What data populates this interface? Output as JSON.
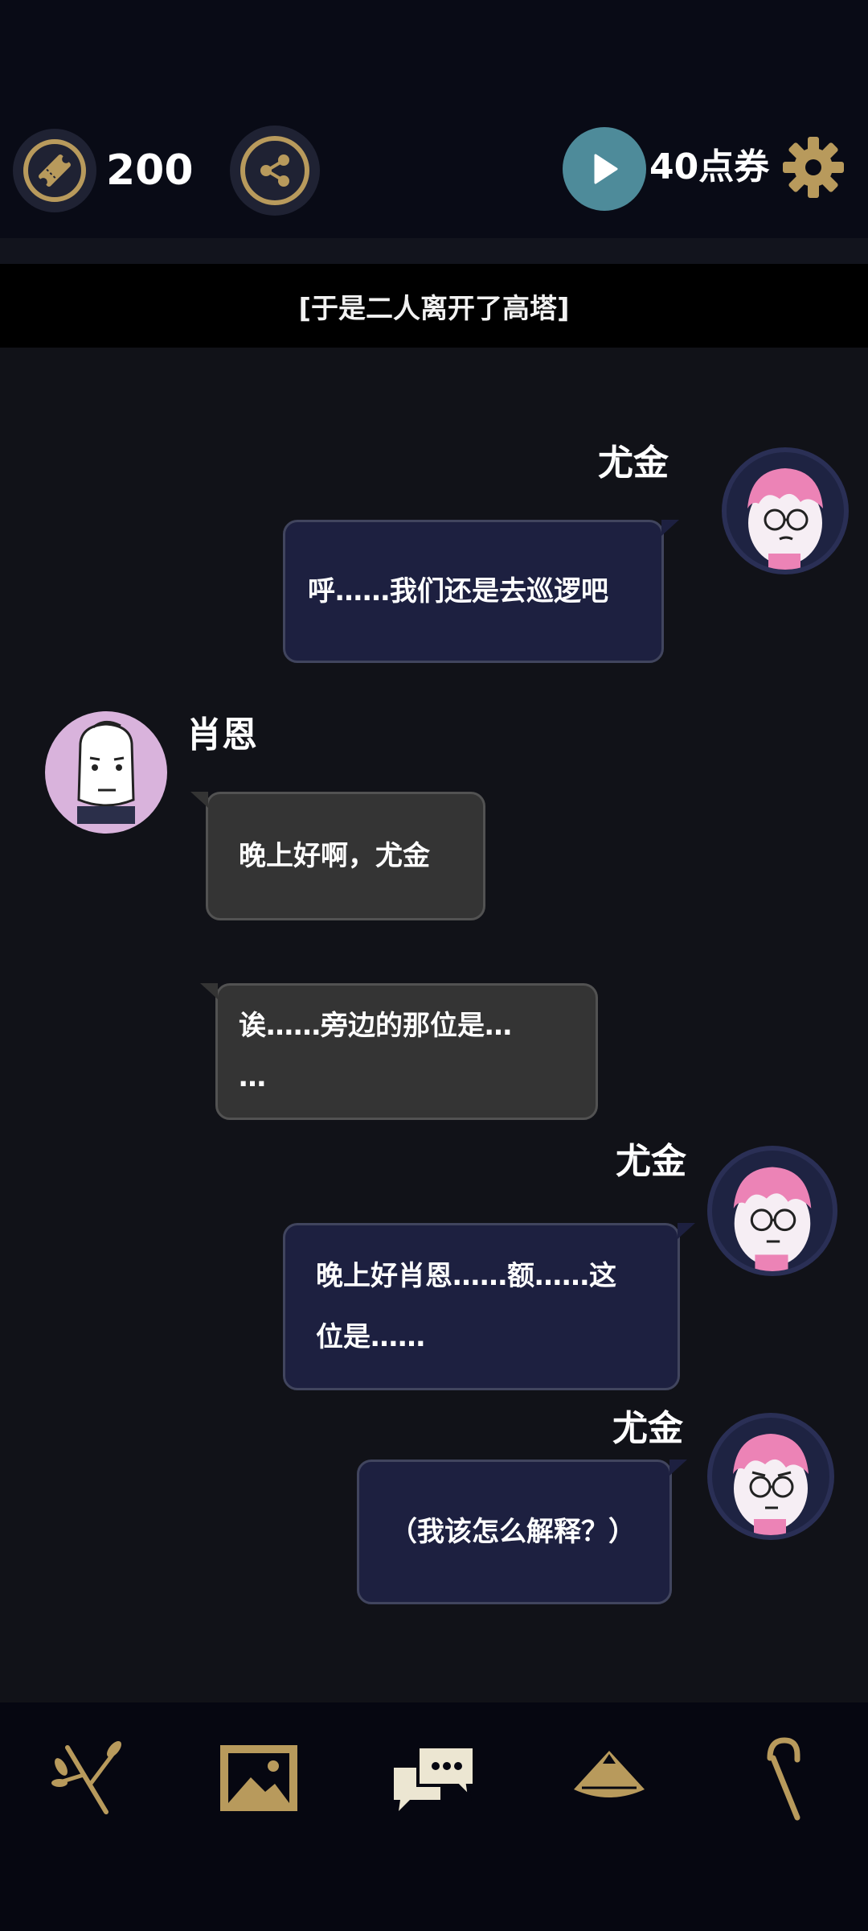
{
  "header": {
    "ticket_count": "200",
    "points_label": "40点券",
    "icons": {
      "ticket": "ticket-icon",
      "share": "share-icon",
      "play": "play-icon",
      "settings": "gear-icon"
    }
  },
  "narration": "[于是二人离开了高塔]",
  "messages": [
    {
      "speaker": "尤金",
      "side": "right",
      "lines": [
        "呼……我们还是去巡逻吧"
      ]
    },
    {
      "speaker": "肖恩",
      "side": "left",
      "lines": [
        "晚上好啊，尤金"
      ]
    },
    {
      "speaker": "",
      "side": "left",
      "lines": [
        "诶……旁边的那位是…",
        "…"
      ]
    },
    {
      "speaker": "尤金",
      "side": "right",
      "lines": [
        "晚上好肖恩……额……这",
        "位是……"
      ]
    },
    {
      "speaker": "尤金",
      "side": "right",
      "lines": [
        "（我该怎么解释？）"
      ]
    }
  ],
  "bottom_nav": {
    "items": [
      "branch-icon",
      "gallery-icon",
      "chat-icon",
      "hat-icon",
      "cane-icon"
    ]
  },
  "colors": {
    "gold": "#b89a5c",
    "play_teal": "#4e8b9a",
    "right_bubble": "#1d2040",
    "left_bubble": "#343434"
  }
}
